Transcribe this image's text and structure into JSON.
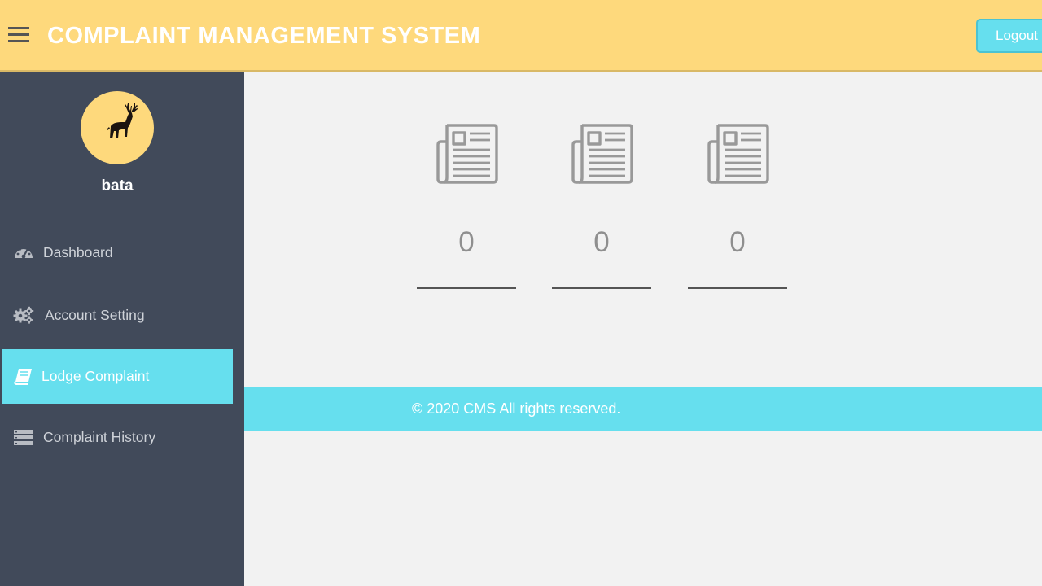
{
  "header": {
    "title": "COMPLAINT MANAGEMENT SYSTEM",
    "logout_label": "Logout",
    "menu_icon": "hamburger-menu-icon"
  },
  "sidebar": {
    "avatar_icon": "elk-icon",
    "username": "bata",
    "items": [
      {
        "label": "Dashboard",
        "icon": "dashboard-gauge-icon",
        "active": false
      },
      {
        "label": "Account Setting",
        "icon": "gears-icon",
        "active": false
      },
      {
        "label": "Lodge Complaint",
        "icon": "book-icon",
        "active": true
      },
      {
        "label": "Complaint History",
        "icon": "server-list-icon",
        "active": false
      }
    ]
  },
  "main": {
    "stats": [
      {
        "icon": "newspaper-icon",
        "count": "0"
      },
      {
        "icon": "newspaper-icon",
        "count": "0"
      },
      {
        "icon": "newspaper-icon",
        "count": "0"
      }
    ]
  },
  "footer": {
    "text": "© 2020 CMS All rights reserved."
  },
  "colors": {
    "header_bg": "#fed97c",
    "sidebar_bg": "#414a5a",
    "accent": "#66dfee",
    "content_bg": "#f2f2f2"
  }
}
